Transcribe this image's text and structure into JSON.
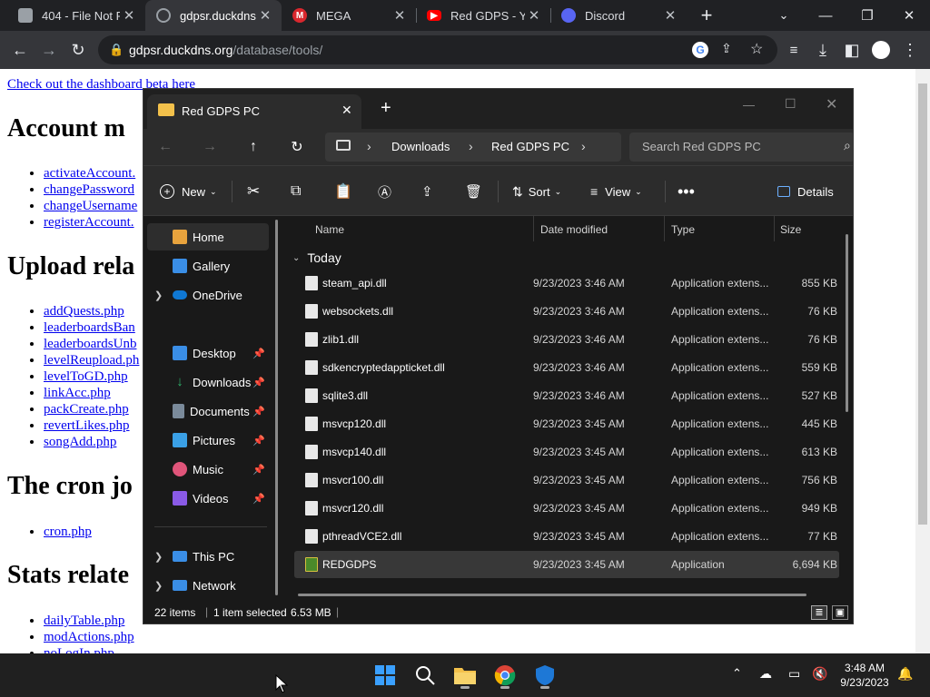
{
  "browser": {
    "tabs": [
      {
        "label": "404 - File Not F",
        "favicon_color": "#9aa0a6",
        "active": false
      },
      {
        "label": "gdpsr.duckdns.",
        "favicon_color": "#9aa0a6",
        "active": true
      },
      {
        "label": "MEGA",
        "favicon_color": "#d9272e",
        "active": false
      },
      {
        "label": "Red GDPS - Yo",
        "favicon_color": "#ff0000",
        "active": false
      },
      {
        "label": "Discord",
        "favicon_color": "#5865f2",
        "active": false
      }
    ],
    "url_host": "gdpsr.duckdns.org",
    "url_path": "/database/tools/"
  },
  "webpage": {
    "beta_link": "Check out the dashboard beta here",
    "heading_account": "Account m",
    "account_links": [
      "activateAccount.",
      "changePassword",
      "changeUsername",
      "registerAccount."
    ],
    "heading_upload": "Upload rela",
    "upload_links": [
      "addQuests.php",
      "leaderboardsBan",
      "leaderboardsUnb",
      "levelReupload.ph",
      "levelToGD.php",
      "linkAcc.php",
      "packCreate.php",
      "revertLikes.php",
      "songAdd.php"
    ],
    "heading_cron": "The cron jo",
    "cron_links": [
      "cron.php"
    ],
    "heading_stats": "Stats relate",
    "stats_links": [
      "dailyTable.php",
      "modActions.php",
      "noLogIn.php"
    ]
  },
  "explorer": {
    "tab_title": "Red GDPS PC",
    "breadcrumb": [
      "Downloads",
      "Red GDPS PC"
    ],
    "search_placeholder": "Search Red GDPS PC",
    "commands": {
      "new": "New",
      "sort": "Sort",
      "view": "View",
      "details": "Details"
    },
    "sidebar": [
      {
        "label": "Home",
        "color": "#e8a33d"
      },
      {
        "label": "Gallery",
        "color": "#3a8ee6"
      },
      {
        "label": "OneDrive",
        "color": "#0f78d4"
      },
      {
        "label": "Desktop",
        "color": "#3a8ee6"
      },
      {
        "label": "Downloads",
        "color": "#2fb36b"
      },
      {
        "label": "Documents",
        "color": "#7a8a9a"
      },
      {
        "label": "Pictures",
        "color": "#3aa0e6"
      },
      {
        "label": "Music",
        "color": "#e0557a"
      },
      {
        "label": "Videos",
        "color": "#8a5ae6"
      },
      {
        "label": "This PC",
        "color": "#3a8ee6"
      },
      {
        "label": "Network",
        "color": "#3a8ee6"
      }
    ],
    "columns": {
      "name": "Name",
      "date": "Date modified",
      "type": "Type",
      "size": "Size"
    },
    "group_label": "Today",
    "files": [
      {
        "name": "steam_api.dll",
        "date": "9/23/2023 3:46 AM",
        "type": "Application extens...",
        "size": "855 KB"
      },
      {
        "name": "websockets.dll",
        "date": "9/23/2023 3:46 AM",
        "type": "Application extens...",
        "size": "76 KB"
      },
      {
        "name": "zlib1.dll",
        "date": "9/23/2023 3:46 AM",
        "type": "Application extens...",
        "size": "76 KB"
      },
      {
        "name": "sdkencryptedappticket.dll",
        "date": "9/23/2023 3:46 AM",
        "type": "Application extens...",
        "size": "559 KB"
      },
      {
        "name": "sqlite3.dll",
        "date": "9/23/2023 3:46 AM",
        "type": "Application extens...",
        "size": "527 KB"
      },
      {
        "name": "msvcp120.dll",
        "date": "9/23/2023 3:45 AM",
        "type": "Application extens...",
        "size": "445 KB"
      },
      {
        "name": "msvcp140.dll",
        "date": "9/23/2023 3:45 AM",
        "type": "Application extens...",
        "size": "613 KB"
      },
      {
        "name": "msvcr100.dll",
        "date": "9/23/2023 3:45 AM",
        "type": "Application extens...",
        "size": "756 KB"
      },
      {
        "name": "msvcr120.dll",
        "date": "9/23/2023 3:45 AM",
        "type": "Application extens...",
        "size": "949 KB"
      },
      {
        "name": "pthreadVCE2.dll",
        "date": "9/23/2023 3:45 AM",
        "type": "Application extens...",
        "size": "77 KB"
      },
      {
        "name": "REDGDPS",
        "date": "9/23/2023 3:45 AM",
        "type": "Application",
        "size": "6,694 KB"
      }
    ],
    "status": {
      "items": "22 items",
      "selected": "1 item selected",
      "selected_size": "6.53 MB"
    }
  },
  "taskbar": {
    "time": "3:48 AM",
    "date": "9/23/2023"
  }
}
